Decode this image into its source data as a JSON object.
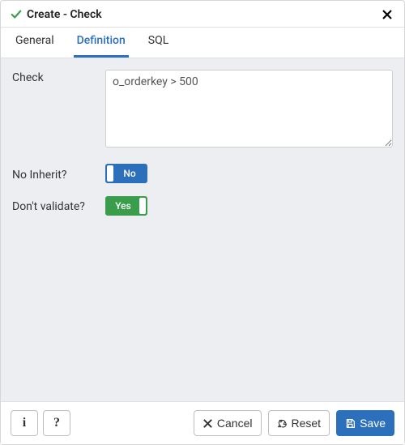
{
  "header": {
    "title": "Create - Check"
  },
  "tabs": {
    "general": "General",
    "definition": "Definition",
    "sql": "SQL"
  },
  "form": {
    "check_label": "Check",
    "check_value": "o_orderkey > 500",
    "no_inherit_label": "No Inherit?",
    "no_inherit_value": "No",
    "dont_validate_label": "Don't validate?",
    "dont_validate_value": "Yes"
  },
  "footer": {
    "info": "i",
    "help": "?",
    "cancel": "Cancel",
    "reset": "Reset",
    "save": "Save"
  }
}
